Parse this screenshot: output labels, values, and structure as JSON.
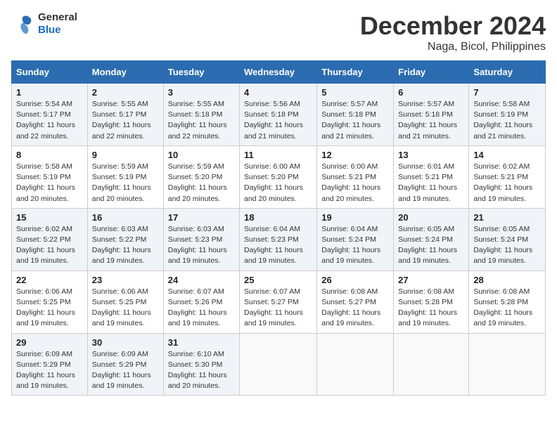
{
  "header": {
    "logo_general": "General",
    "logo_blue": "Blue",
    "month_title": "December 2024",
    "location": "Naga, Bicol, Philippines"
  },
  "weekdays": [
    "Sunday",
    "Monday",
    "Tuesday",
    "Wednesday",
    "Thursday",
    "Friday",
    "Saturday"
  ],
  "weeks": [
    [
      {
        "day": "1",
        "sunrise": "Sunrise: 5:54 AM",
        "sunset": "Sunset: 5:17 PM",
        "daylight": "Daylight: 11 hours and 22 minutes."
      },
      {
        "day": "2",
        "sunrise": "Sunrise: 5:55 AM",
        "sunset": "Sunset: 5:17 PM",
        "daylight": "Daylight: 11 hours and 22 minutes."
      },
      {
        "day": "3",
        "sunrise": "Sunrise: 5:55 AM",
        "sunset": "Sunset: 5:18 PM",
        "daylight": "Daylight: 11 hours and 22 minutes."
      },
      {
        "day": "4",
        "sunrise": "Sunrise: 5:56 AM",
        "sunset": "Sunset: 5:18 PM",
        "daylight": "Daylight: 11 hours and 21 minutes."
      },
      {
        "day": "5",
        "sunrise": "Sunrise: 5:57 AM",
        "sunset": "Sunset: 5:18 PM",
        "daylight": "Daylight: 11 hours and 21 minutes."
      },
      {
        "day": "6",
        "sunrise": "Sunrise: 5:57 AM",
        "sunset": "Sunset: 5:18 PM",
        "daylight": "Daylight: 11 hours and 21 minutes."
      },
      {
        "day": "7",
        "sunrise": "Sunrise: 5:58 AM",
        "sunset": "Sunset: 5:19 PM",
        "daylight": "Daylight: 11 hours and 21 minutes."
      }
    ],
    [
      {
        "day": "8",
        "sunrise": "Sunrise: 5:58 AM",
        "sunset": "Sunset: 5:19 PM",
        "daylight": "Daylight: 11 hours and 20 minutes."
      },
      {
        "day": "9",
        "sunrise": "Sunrise: 5:59 AM",
        "sunset": "Sunset: 5:19 PM",
        "daylight": "Daylight: 11 hours and 20 minutes."
      },
      {
        "day": "10",
        "sunrise": "Sunrise: 5:59 AM",
        "sunset": "Sunset: 5:20 PM",
        "daylight": "Daylight: 11 hours and 20 minutes."
      },
      {
        "day": "11",
        "sunrise": "Sunrise: 6:00 AM",
        "sunset": "Sunset: 5:20 PM",
        "daylight": "Daylight: 11 hours and 20 minutes."
      },
      {
        "day": "12",
        "sunrise": "Sunrise: 6:00 AM",
        "sunset": "Sunset: 5:21 PM",
        "daylight": "Daylight: 11 hours and 20 minutes."
      },
      {
        "day": "13",
        "sunrise": "Sunrise: 6:01 AM",
        "sunset": "Sunset: 5:21 PM",
        "daylight": "Daylight: 11 hours and 19 minutes."
      },
      {
        "day": "14",
        "sunrise": "Sunrise: 6:02 AM",
        "sunset": "Sunset: 5:21 PM",
        "daylight": "Daylight: 11 hours and 19 minutes."
      }
    ],
    [
      {
        "day": "15",
        "sunrise": "Sunrise: 6:02 AM",
        "sunset": "Sunset: 5:22 PM",
        "daylight": "Daylight: 11 hours and 19 minutes."
      },
      {
        "day": "16",
        "sunrise": "Sunrise: 6:03 AM",
        "sunset": "Sunset: 5:22 PM",
        "daylight": "Daylight: 11 hours and 19 minutes."
      },
      {
        "day": "17",
        "sunrise": "Sunrise: 6:03 AM",
        "sunset": "Sunset: 5:23 PM",
        "daylight": "Daylight: 11 hours and 19 minutes."
      },
      {
        "day": "18",
        "sunrise": "Sunrise: 6:04 AM",
        "sunset": "Sunset: 5:23 PM",
        "daylight": "Daylight: 11 hours and 19 minutes."
      },
      {
        "day": "19",
        "sunrise": "Sunrise: 6:04 AM",
        "sunset": "Sunset: 5:24 PM",
        "daylight": "Daylight: 11 hours and 19 minutes."
      },
      {
        "day": "20",
        "sunrise": "Sunrise: 6:05 AM",
        "sunset": "Sunset: 5:24 PM",
        "daylight": "Daylight: 11 hours and 19 minutes."
      },
      {
        "day": "21",
        "sunrise": "Sunrise: 6:05 AM",
        "sunset": "Sunset: 5:24 PM",
        "daylight": "Daylight: 11 hours and 19 minutes."
      }
    ],
    [
      {
        "day": "22",
        "sunrise": "Sunrise: 6:06 AM",
        "sunset": "Sunset: 5:25 PM",
        "daylight": "Daylight: 11 hours and 19 minutes."
      },
      {
        "day": "23",
        "sunrise": "Sunrise: 6:06 AM",
        "sunset": "Sunset: 5:25 PM",
        "daylight": "Daylight: 11 hours and 19 minutes."
      },
      {
        "day": "24",
        "sunrise": "Sunrise: 6:07 AM",
        "sunset": "Sunset: 5:26 PM",
        "daylight": "Daylight: 11 hours and 19 minutes."
      },
      {
        "day": "25",
        "sunrise": "Sunrise: 6:07 AM",
        "sunset": "Sunset: 5:27 PM",
        "daylight": "Daylight: 11 hours and 19 minutes."
      },
      {
        "day": "26",
        "sunrise": "Sunrise: 6:08 AM",
        "sunset": "Sunset: 5:27 PM",
        "daylight": "Daylight: 11 hours and 19 minutes."
      },
      {
        "day": "27",
        "sunrise": "Sunrise: 6:08 AM",
        "sunset": "Sunset: 5:28 PM",
        "daylight": "Daylight: 11 hours and 19 minutes."
      },
      {
        "day": "28",
        "sunrise": "Sunrise: 6:08 AM",
        "sunset": "Sunset: 5:28 PM",
        "daylight": "Daylight: 11 hours and 19 minutes."
      }
    ],
    [
      {
        "day": "29",
        "sunrise": "Sunrise: 6:09 AM",
        "sunset": "Sunset: 5:29 PM",
        "daylight": "Daylight: 11 hours and 19 minutes."
      },
      {
        "day": "30",
        "sunrise": "Sunrise: 6:09 AM",
        "sunset": "Sunset: 5:29 PM",
        "daylight": "Daylight: 11 hours and 19 minutes."
      },
      {
        "day": "31",
        "sunrise": "Sunrise: 6:10 AM",
        "sunset": "Sunset: 5:30 PM",
        "daylight": "Daylight: 11 hours and 20 minutes."
      },
      null,
      null,
      null,
      null
    ]
  ]
}
